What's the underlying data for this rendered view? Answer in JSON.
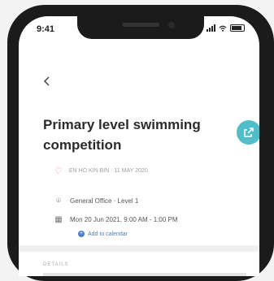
{
  "status_bar": {
    "time": "9:41"
  },
  "event": {
    "title": "Primary level swimming competition",
    "meta": "EN HO KIN BIN · 11 MAY 2020",
    "location": "General Office · Level 1",
    "datetime": "Mon 20 Jun 2021, 9:00 AM - 1:00 PM",
    "add_to_calendar": "Add to calendar"
  },
  "details": {
    "section_label": "DETAILS"
  },
  "colors": {
    "accent": "#53bcc9",
    "link": "#4a7ec8",
    "heart": "#e27a6a"
  },
  "icons": {
    "back": "chevron-left-icon",
    "share": "share-icon",
    "heart": "heart-icon",
    "location": "location-pin-icon",
    "calendar": "calendar-icon",
    "plus": "plus-icon"
  }
}
